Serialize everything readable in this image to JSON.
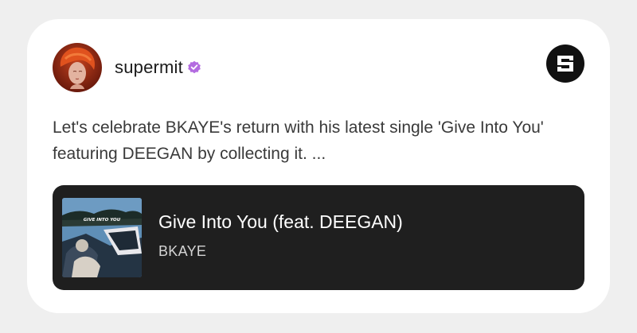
{
  "post": {
    "author": {
      "username": "supermit",
      "verified": true,
      "avatar_icon": "avatar-portrait-icon"
    },
    "platform_icon": "sound-logo-icon",
    "text": "Let's celebrate BKAYE's return with his latest single 'Give Into You' featuring DEEGAN by collecting it. ...",
    "track": {
      "title": "Give Into You (feat. DEEGAN)",
      "artist": "BKAYE",
      "cover_text": "GIVE INTO YOU"
    }
  },
  "colors": {
    "page_background": "#efefef",
    "card_background": "#ffffff",
    "track_card_background": "#1f1f1f",
    "verified_badge": "#b36be0",
    "text_primary": "#1a1a1a",
    "text_body": "#3a3a3a"
  }
}
